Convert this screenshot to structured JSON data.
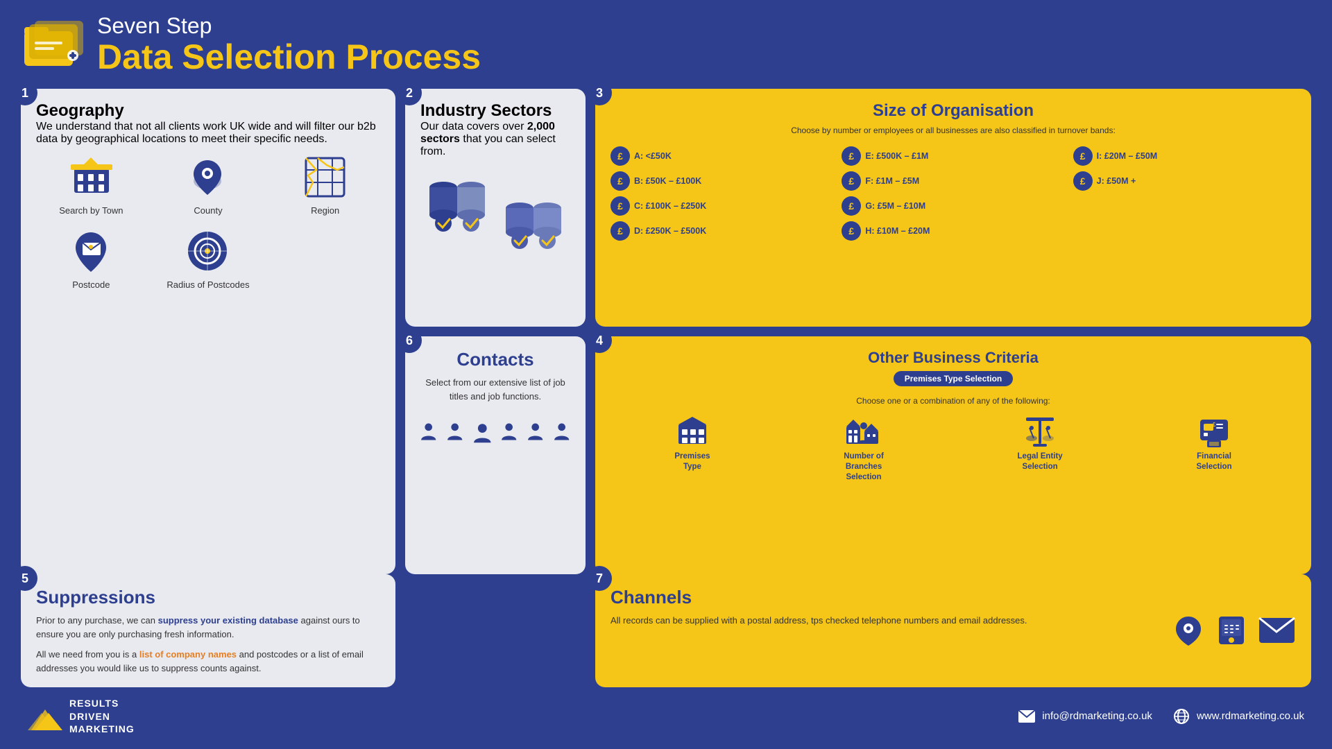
{
  "header": {
    "subtitle": "Seven Step",
    "title": "Data Selection Process"
  },
  "step1": {
    "number": "1",
    "title": "Geography",
    "description": "We understand that not all clients work UK wide and will filter our b2b data by geographical locations to meet their specific needs.",
    "icons": [
      {
        "name": "Search by Town",
        "icon": "building"
      },
      {
        "name": "County",
        "icon": "location"
      },
      {
        "name": "Region",
        "icon": "region"
      },
      {
        "name": "Postcode",
        "icon": "postcode"
      },
      {
        "name": "Radius of Postcodes",
        "icon": "radius"
      }
    ]
  },
  "step2": {
    "number": "2",
    "title": "Industry Sectors",
    "description": "Our data covers over ",
    "highlight": "2,000 sectors",
    "description2": " that you can select from."
  },
  "step3": {
    "number": "3",
    "title": "Size of Organisation",
    "subtitle": "Choose by number or employees or all businesses are also classified in turnover bands:",
    "bands": [
      {
        "label": "A: <£50K"
      },
      {
        "label": "B: £50K – £100K"
      },
      {
        "label": "C: £100K – £250K"
      },
      {
        "label": "D: £250K – £500K"
      },
      {
        "label": "E: £500K – £1M"
      },
      {
        "label": "F: £1M – £5M"
      },
      {
        "label": "G: £5M – £10M"
      },
      {
        "label": "H: £10M – £20M"
      },
      {
        "label": "I: £20M – £50M"
      },
      {
        "label": "J: £50M +"
      }
    ]
  },
  "step4": {
    "number": "4",
    "title": "Other Business Criteria",
    "badge": "Premises Type Selection",
    "subtitle": "Choose one or a combination of any of the following:",
    "options": [
      {
        "name": "Premises Type"
      },
      {
        "name": "Number of Branches Selection"
      },
      {
        "name": "Legal Entity Selection"
      },
      {
        "name": "Financial Selection"
      }
    ]
  },
  "step5": {
    "number": "5",
    "title": "Suppressions",
    "para1": "Prior to any purchase, we can ",
    "highlight1": "suppress your existing database",
    "para1b": " against ours to ensure you are only purchasing fresh information.",
    "para2": "All we need from you is a ",
    "highlight2": "list of company names",
    "para2b": " and postcodes or a list of email addresses you would like us to suppress counts against."
  },
  "step6": {
    "number": "6",
    "title": "Contacts",
    "description": "Select from our extensive list of job titles and job functions."
  },
  "step7": {
    "number": "7",
    "title": "Channels",
    "description": "All records can be supplied with a postal address, tps checked telephone numbers and email addresses."
  },
  "footer": {
    "logo_line1": "RESULTS",
    "logo_line2": "DRIVEN",
    "logo_line3": "MARKETING",
    "email": "info@rdmarketing.co.uk",
    "website": "www.rdmarketing.co.uk"
  }
}
